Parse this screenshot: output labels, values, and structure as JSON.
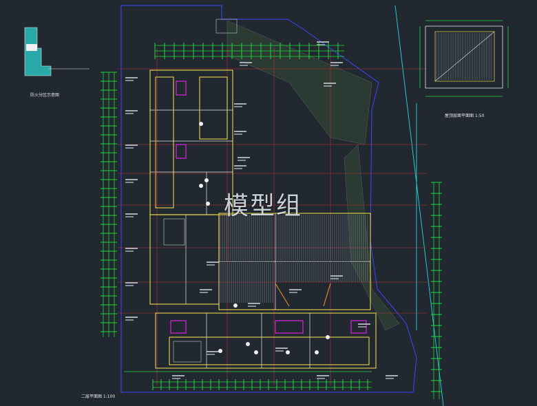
{
  "watermark": "模型组",
  "labels": {
    "detail_left": "防火分区示意图",
    "detail_right": "屋顶层面平面图 1:50",
    "main_plan": "二层平面图 1:100"
  },
  "colors": {
    "background": "#212830",
    "grid_green": "#22d93b",
    "wall_yellow": "#d9c84a",
    "section_red": "#c0303a",
    "site_blue": "#2c3cff",
    "cyan": "#22cbd0",
    "magenta": "#e020e0",
    "hatch": "#9aa3ad",
    "orange": "#d98a2a"
  }
}
